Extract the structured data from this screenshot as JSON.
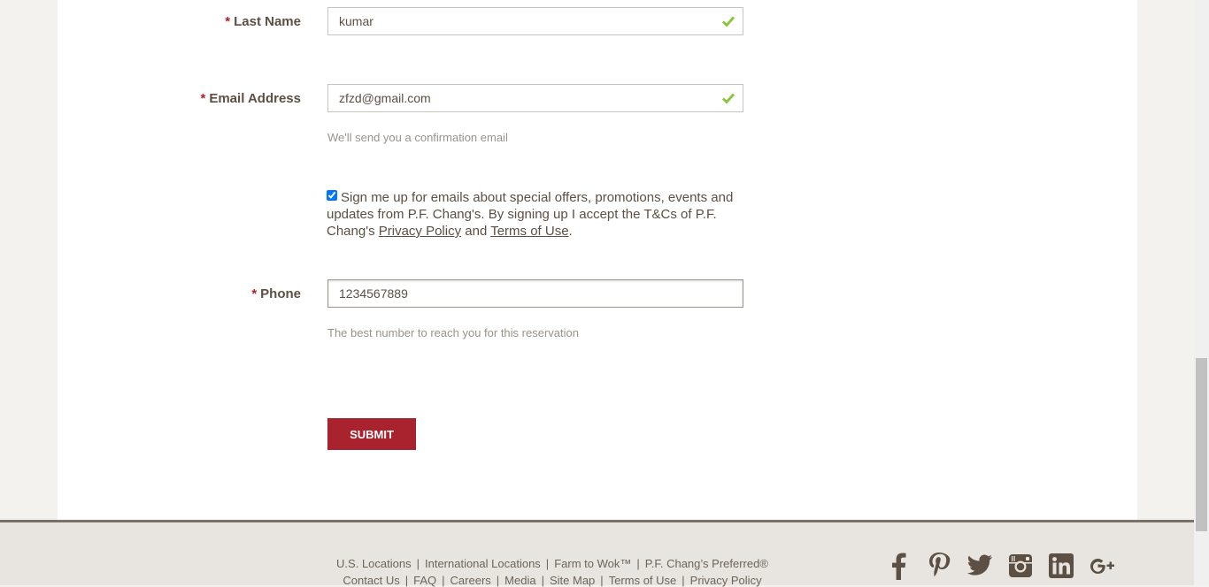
{
  "form": {
    "required_marker": "*",
    "last_name": {
      "label": "Last Name",
      "value": "kumar"
    },
    "email": {
      "label": "Email Address",
      "value": "zfzd@gmail.com",
      "hint": "We'll send you a confirmation email"
    },
    "optin": {
      "checked": true,
      "text_before": "Sign me up for emails about special offers, promotions, events and updates from P.F. Chang's. By signing up I accept the T&Cs of P.F. Chang's ",
      "privacy_link": "Privacy Policy",
      "and": " and ",
      "terms_link": "Terms of Use",
      "period": "."
    },
    "phone": {
      "label": "Phone",
      "value": "1234567889",
      "hint": "The best number to reach you for this reservation"
    },
    "submit_label": "SUBMIT"
  },
  "footer": {
    "row1": [
      "U.S. Locations",
      "International Locations",
      "Farm to Wok™",
      "P.F. Chang’s Preferred®"
    ],
    "row2": [
      "Contact Us",
      "FAQ",
      "Careers",
      "Media",
      "Site Map",
      "Terms of Use",
      "Privacy Policy"
    ],
    "separator": "|",
    "social_icons": [
      "facebook-icon",
      "pinterest-icon",
      "twitter-icon",
      "instagram-icon",
      "linkedin-icon",
      "google-plus-icon"
    ]
  },
  "colors": {
    "accent": "#a8232d",
    "valid_check": "#8cc63f",
    "text": "#5c4f43",
    "hint": "#9a928a"
  }
}
